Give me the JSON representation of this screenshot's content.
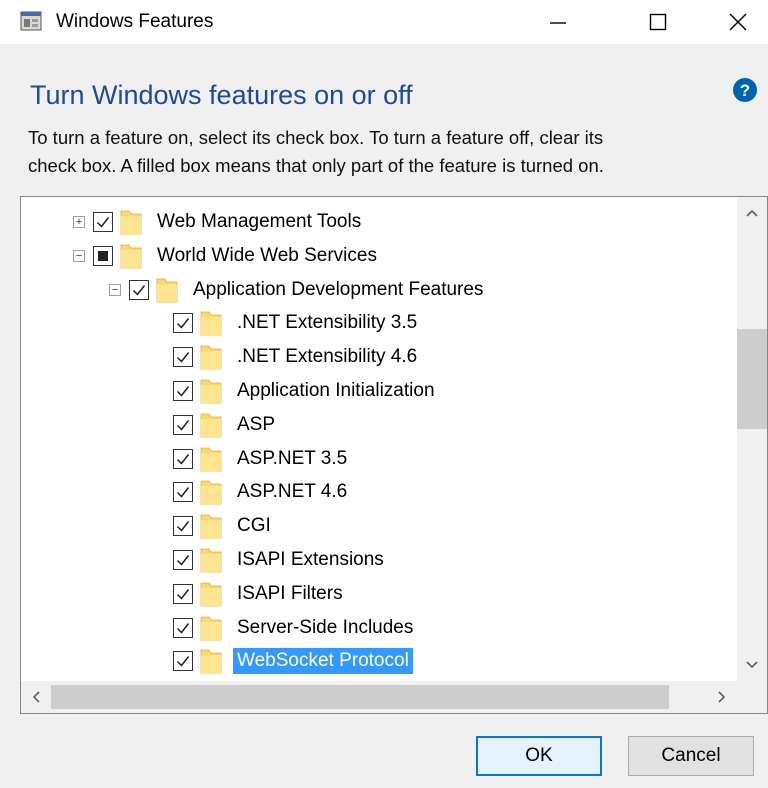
{
  "window": {
    "title": "Windows Features"
  },
  "header": {
    "heading": "Turn Windows features on or off",
    "description_line1": "To turn a feature on, select its check box. To turn a feature off, clear its",
    "description_line2": "check box. A filled box means that only part of the feature is turned on."
  },
  "tree": {
    "items": [
      {
        "label": "Web Management Tools",
        "state": "checked",
        "expander": "plus",
        "level": 0
      },
      {
        "label": "World Wide Web Services",
        "state": "partial",
        "expander": "minus",
        "level": 0
      },
      {
        "label": "Application Development Features",
        "state": "checked",
        "expander": "minus",
        "level": 1
      },
      {
        "label": ".NET Extensibility 3.5",
        "state": "checked",
        "level": 2
      },
      {
        "label": ".NET Extensibility 4.6",
        "state": "checked",
        "level": 2
      },
      {
        "label": "Application Initialization",
        "state": "checked",
        "level": 2
      },
      {
        "label": "ASP",
        "state": "checked",
        "level": 2
      },
      {
        "label": "ASP.NET 3.5",
        "state": "checked",
        "level": 2
      },
      {
        "label": "ASP.NET 4.6",
        "state": "checked",
        "level": 2
      },
      {
        "label": "CGI",
        "state": "checked",
        "level": 2
      },
      {
        "label": "ISAPI Extensions",
        "state": "checked",
        "level": 2
      },
      {
        "label": "ISAPI Filters",
        "state": "checked",
        "level": 2
      },
      {
        "label": "Server-Side Includes",
        "state": "checked",
        "level": 2
      },
      {
        "label": "WebSocket Protocol",
        "state": "checked",
        "level": 2,
        "selected": true
      }
    ]
  },
  "buttons": {
    "ok": "OK",
    "cancel": "Cancel"
  },
  "colors": {
    "heading": "#1f4a9a",
    "selection": "#3399ff",
    "help_icon": "#0063b1",
    "folder": "#ffd76a"
  }
}
